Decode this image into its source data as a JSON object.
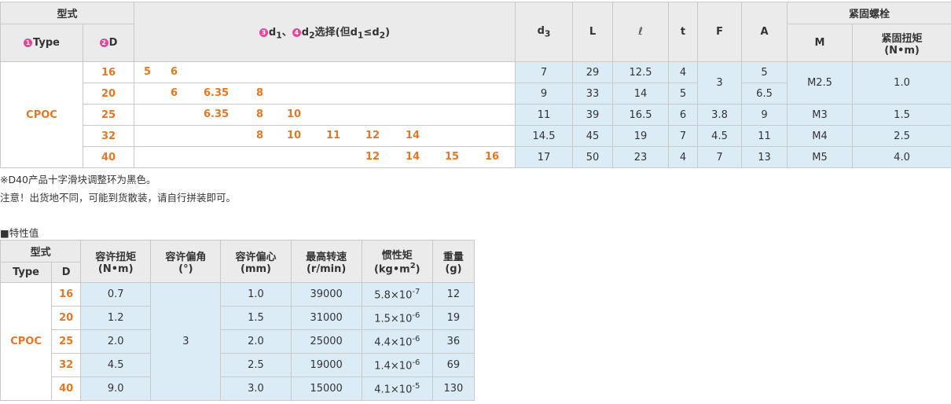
{
  "spec_table": {
    "header": {
      "model_group": "型式",
      "type_label": "Type",
      "type_circle": "1",
      "d_label": "D",
      "d_circle": "2",
      "d12_circle1": "3",
      "d12_circle2": "4",
      "d12_title_pre": "d",
      "d12_sub1": "1",
      "d12_sep": "、",
      "d12_sub2": "2",
      "d12_title_post": "选择(但d",
      "d12_cond_sub1": "1",
      "d12_cond": "≤d",
      "d12_cond_sub2": "2",
      "d12_close": ")",
      "d3": "d",
      "d3_sub": "3",
      "L": "L",
      "ell": "ℓ",
      "t": "t",
      "F": "F",
      "A": "A",
      "bolt_group": "紧固螺栓",
      "M": "M",
      "torque_label": "紧固扭矩",
      "torque_unit": "(N•m)"
    },
    "type_value": "CPOC",
    "rows": [
      {
        "D": "16",
        "d": [
          "5",
          "6",
          "",
          "",
          "",
          "",
          "",
          "",
          "",
          ""
        ],
        "d3": "7",
        "L": "29",
        "ell": "12.5",
        "t": "4",
        "A": "5"
      },
      {
        "D": "20",
        "d": [
          "",
          "6",
          "6.35",
          "8",
          "",
          "",
          "",
          "",
          "",
          ""
        ],
        "d3": "9",
        "L": "33",
        "ell": "14",
        "t": "5",
        "A": "6.5"
      },
      {
        "D": "25",
        "d": [
          "",
          "",
          "6.35",
          "8",
          "10",
          "",
          "",
          "",
          "",
          ""
        ],
        "d3": "11",
        "L": "39",
        "ell": "16.5",
        "t": "6",
        "F": "3.8",
        "A": "9",
        "M": "M3",
        "torque": "1.5"
      },
      {
        "D": "32",
        "d": [
          "",
          "",
          "",
          "8",
          "10",
          "11",
          "12",
          "14",
          "",
          ""
        ],
        "d3": "14.5",
        "L": "45",
        "ell": "19",
        "t": "7",
        "F": "4.5",
        "A": "11",
        "M": "M4",
        "torque": "2.5"
      },
      {
        "D": "40",
        "d": [
          "",
          "",
          "",
          "",
          "",
          "",
          "12",
          "14",
          "15",
          "16"
        ],
        "d3": "17",
        "L": "50",
        "ell": "23",
        "t": "4",
        "F": "7",
        "A": "13",
        "M": "M5",
        "torque": "4.0"
      }
    ],
    "merged_F_16_20": "3",
    "merged_M_16_20": "M2.5",
    "merged_torque_16_20": "1.0"
  },
  "notes": {
    "note1": "※D40产品十字滑块调整环为黑色。",
    "note2": "注意！出货地不同，可能到货散装，请自行拼装即可。",
    "section_title": "■特性值"
  },
  "prop_table": {
    "header": {
      "model_group": "型式",
      "type_label": "Type",
      "d_label": "D",
      "torque": "容许扭矩",
      "torque_unit": "(N•m)",
      "angle": "容许偏角",
      "angle_unit": "(°)",
      "offset": "容许偏心",
      "offset_unit": "(mm)",
      "speed": "最高转速",
      "speed_unit": "(r/min)",
      "inertia": "惯性矩",
      "inertia_unit_pre": "(kg•m",
      "inertia_unit_exp": "2",
      "inertia_unit_post": ")",
      "weight": "重量",
      "weight_unit": "(g)"
    },
    "type_value": "CPOC",
    "angle_merged": "3",
    "rows": [
      {
        "D": "16",
        "torque": "0.7",
        "offset": "1.0",
        "speed": "39000",
        "inertia_m": "5.8×10",
        "inertia_e": "-7",
        "weight": "12"
      },
      {
        "D": "20",
        "torque": "1.2",
        "offset": "1.5",
        "speed": "31000",
        "inertia_m": "1.5×10",
        "inertia_e": "-6",
        "weight": "19"
      },
      {
        "D": "25",
        "torque": "2.0",
        "offset": "2.0",
        "speed": "25000",
        "inertia_m": "4.4×10",
        "inertia_e": "-6",
        "weight": "36"
      },
      {
        "D": "32",
        "torque": "4.5",
        "offset": "2.5",
        "speed": "19000",
        "inertia_m": "1.4×10",
        "inertia_e": "-6",
        "weight": "69"
      },
      {
        "D": "40",
        "torque": "9.0",
        "offset": "3.0",
        "speed": "15000",
        "inertia_m": "4.1×10",
        "inertia_e": "-5",
        "weight": "130"
      }
    ]
  },
  "colors": {
    "header_bg": "#ebebeb",
    "blue_bg": "#dcecf7",
    "orange": "#e07826",
    "circle": "#e8449a",
    "border": "#c9c9c9"
  }
}
